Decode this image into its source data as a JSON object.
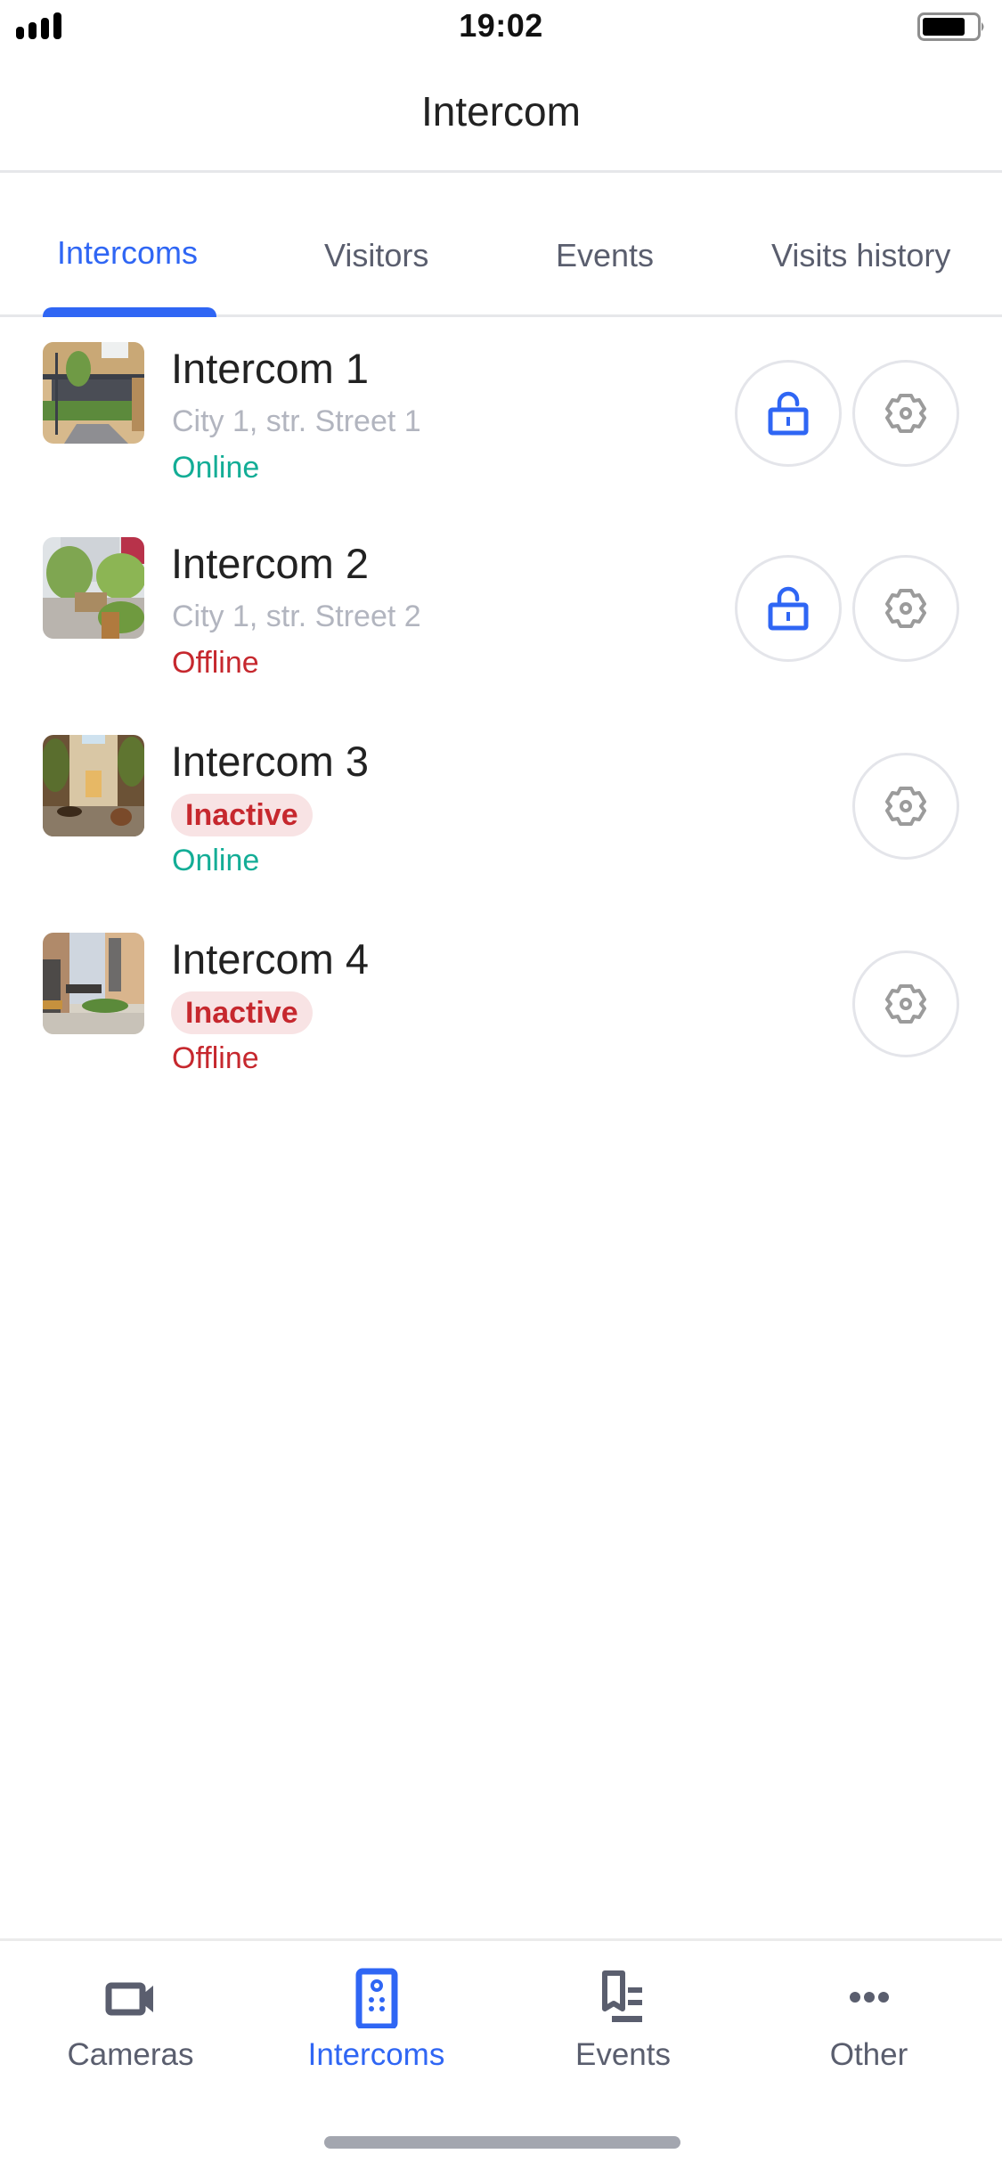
{
  "status_bar": {
    "time": "19:02",
    "signal_bars": 4,
    "battery_level": 0.8
  },
  "header": {
    "title": "Intercom"
  },
  "tabs": [
    {
      "label": "Intercoms",
      "active": true
    },
    {
      "label": "Visitors",
      "active": false
    },
    {
      "label": "Events",
      "active": false
    },
    {
      "label": "Visits history",
      "active": false
    }
  ],
  "intercoms": [
    {
      "name": "Intercom 1",
      "address": "City 1, str. Street 1",
      "badge": null,
      "status": "Online",
      "status_type": "online",
      "can_unlock": true,
      "thumbnail": "courtyard-walkway-photo"
    },
    {
      "name": "Intercom 2",
      "address": "City 1, str. Street 2",
      "badge": null,
      "status": "Offline",
      "status_type": "offline",
      "can_unlock": true,
      "thumbnail": "park-plaza-photo"
    },
    {
      "name": "Intercom 3",
      "address": null,
      "badge": "Inactive",
      "status": "Online",
      "status_type": "online",
      "can_unlock": false,
      "thumbnail": "old-town-courtyard-photo"
    },
    {
      "name": "Intercom 4",
      "address": null,
      "badge": "Inactive",
      "status": "Offline",
      "status_type": "offline",
      "can_unlock": false,
      "thumbnail": "apartment-yard-photo"
    }
  ],
  "icons": {
    "unlock": "lock-open-icon",
    "settings": "gear-icon"
  },
  "bottom_nav": [
    {
      "label": "Cameras",
      "icon": "video-camera-icon",
      "active": false
    },
    {
      "label": "Intercoms",
      "icon": "intercom-panel-icon",
      "active": true
    },
    {
      "label": "Events",
      "icon": "bookmark-list-icon",
      "active": false
    },
    {
      "label": "Other",
      "icon": "more-dots-icon",
      "active": false
    }
  ],
  "colors": {
    "accent": "#2f66f4",
    "online": "#13ad96",
    "offline": "#c6282e",
    "badge_bg": "#f8e3e4",
    "muted_text": "#b2b5bf",
    "tab_inactive": "#5a5e6e",
    "icon_gray": "#9b9b9b"
  }
}
